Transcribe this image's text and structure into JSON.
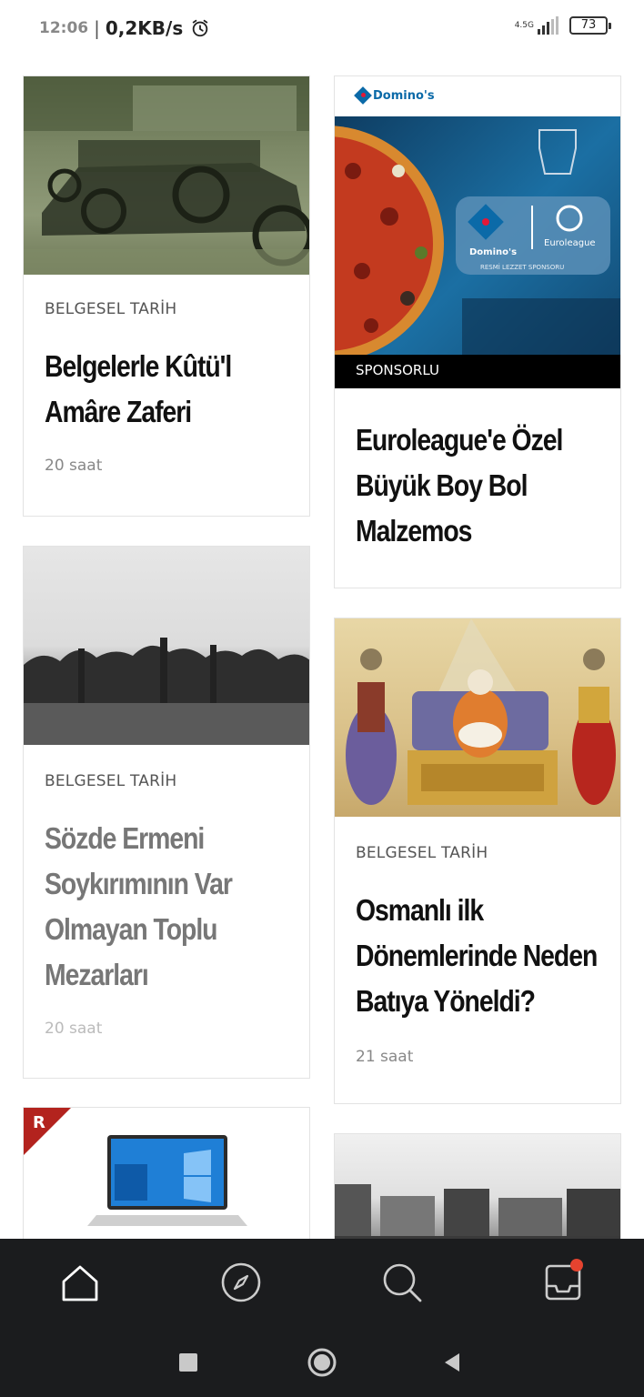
{
  "status_bar": {
    "time": "12:06",
    "separator": "|",
    "data_rate": "0,2KB/s",
    "network": "4.5G",
    "battery": "73",
    "icons": [
      "alarm-icon",
      "signal-icon",
      "battery-icon"
    ]
  },
  "feed": {
    "cards": [
      {
        "category": "BELGESEL TARİH",
        "title_lines": [
          "Belgelerle Kûtü'l",
          "Amâre Zaferi"
        ],
        "time": "20 saat"
      },
      {
        "brand": "Domino's",
        "badge_label": "SPONSORLU",
        "title_lines": [
          "Euroleague'e Özel",
          "Büyük Boy Bol",
          "Malzemos"
        ]
      },
      {
        "category": "BELGESEL TARİH",
        "title_lines": [
          "Sözde Ermeni",
          "Soykırımının Var",
          "Olmayan Toplu",
          "Mezarları"
        ],
        "time": "20 saat"
      },
      {
        "category": "BELGESEL TARİH",
        "title_lines": [
          "Osmanlı ilk",
          "Dönemlerinde Neden",
          "Batıya Yöneldi?"
        ],
        "time": "21 saat"
      },
      {
        "corner_label": "R"
      },
      {}
    ]
  },
  "bottom_nav": {
    "items": [
      "home-icon",
      "explore-icon",
      "search-icon",
      "inbox-icon"
    ]
  },
  "system_nav": {
    "items": [
      "recents-icon",
      "home-circle-icon",
      "back-icon"
    ]
  },
  "colors": {
    "nav_background": "#1b1c1e",
    "badge": "#e5432f",
    "sponsor_bar": "#000000",
    "domino_blue": "#0b6aa8",
    "domino_red": "#e31837",
    "corner_red": "#b3231e"
  }
}
